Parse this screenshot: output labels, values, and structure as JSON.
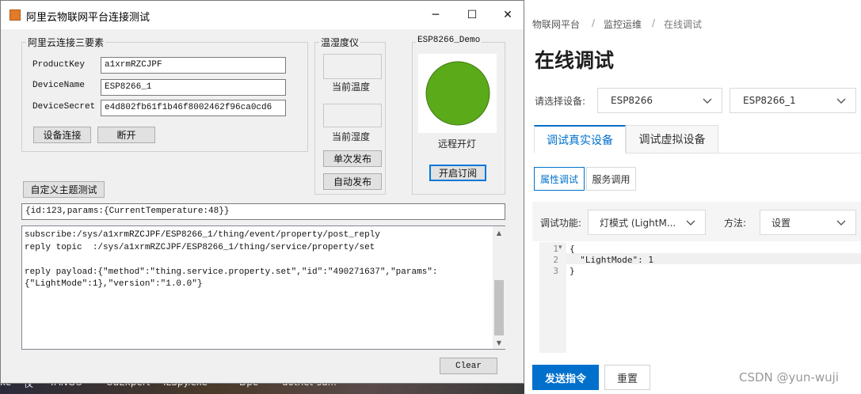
{
  "colors": {
    "accent": "#0070cc",
    "led": "#5aaa1a",
    "desktop_icon_orange": "#e07b2a"
  },
  "taskbar": {
    "items": [
      "xe",
      "仪",
      "TANGO",
      "UaExpert",
      "ILSpy.exe",
      "Dpe",
      "dotnet-sd..."
    ]
  },
  "window": {
    "title": "阿里云物联网平台连接测试",
    "controls": {
      "minimize": "─",
      "maximize": "☐",
      "close": "✕"
    },
    "connect_group": {
      "title": "阿里云连接三要素",
      "product_key_label": "ProductKey",
      "product_key_value": "a1xrmRZCJPF",
      "device_name_label": "DeviceName",
      "device_name_value": "ESP8266_1",
      "device_secret_label": "DeviceSecret",
      "device_secret_value": "e4d802fb61f1b46f8002462f96ca0cd6",
      "connect_button": "设备连接",
      "disconnect_button": "断开"
    },
    "sensor_group": {
      "title": "温湿度仪",
      "temp_label": "当前温度",
      "humidity_label": "当前湿度",
      "single_publish_button": "单次发布",
      "auto_publish_button": "自动发布"
    },
    "esp_group": {
      "title": "ESP8266_Demo",
      "led_label": "远程开灯",
      "subscribe_button": "开启订阅"
    },
    "custom_topic_button": "自定义主题测试",
    "payload_input": "{id:123,params:{CurrentTemperature:48}}",
    "log_text": "subscribe:/sys/a1xrmRZCJPF/ESP8266_1/thing/event/property/post_reply\nreply topic  :/sys/a1xrmRZCJPF/ESP8266_1/thing/service/property/set\n\nreply payload:{\"method\":\"thing.service.property.set\",\"id\":\"490271637\",\"params\":\n{\"LightMode\":1},\"version\":\"1.0.0\"}",
    "clear_button": "Clear",
    "scroll_up": "▲",
    "scroll_down": "▼"
  },
  "web": {
    "breadcrumb": [
      "物联网平台",
      "监控运维",
      "在线调试"
    ],
    "breadcrumb_sep": "/",
    "page_title": "在线调试",
    "device_select_label": "请选择设备:",
    "product_select": "ESP8266",
    "device_select": "ESP8266_1",
    "tabs": [
      "调试真实设备",
      "调试虚拟设备"
    ],
    "subtabs": [
      "属性调试",
      "服务调用"
    ],
    "function_label": "调试功能:",
    "function_select": "灯模式 (LightM...",
    "method_label": "方法:",
    "method_select": "设置",
    "editor": {
      "line_numbers": [
        "1",
        "2",
        "3"
      ],
      "fold_marker": "▾",
      "lines": [
        "{",
        "  \"LightMode\": 1",
        "}"
      ]
    },
    "send_button": "发送指令",
    "reset_button": "重置",
    "watermark": "CSDN @yun-wuji"
  }
}
